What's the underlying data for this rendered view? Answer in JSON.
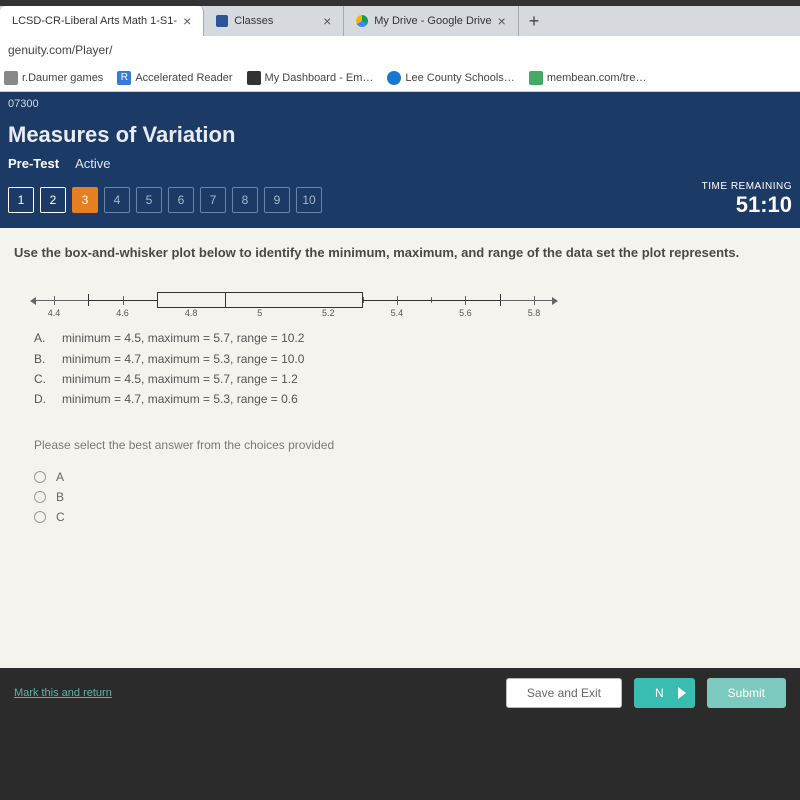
{
  "tabs": [
    {
      "title": "LCSD-CR-Liberal Arts Math 1-S1-",
      "active": true
    },
    {
      "title": "Classes"
    },
    {
      "title": "My Drive - Google Drive"
    }
  ],
  "url": "genuity.com/Player/",
  "bookmarks": [
    {
      "label": "r.Daumer games"
    },
    {
      "label": "Accelerated Reader"
    },
    {
      "label": "My Dashboard - Em…"
    },
    {
      "label": "Lee County Schools…"
    },
    {
      "label": "membean.com/tre…"
    }
  ],
  "course_code": "07300",
  "title": "Measures of Variation",
  "subnav": {
    "pretest": "Pre-Test",
    "active": "Active"
  },
  "questions": [
    "1",
    "2",
    "3",
    "4",
    "5",
    "6",
    "7",
    "8",
    "9",
    "10"
  ],
  "current_q": 3,
  "timer": {
    "label": "TIME REMAINING",
    "value": "51:10"
  },
  "prompt": "Use the box-and-whisker plot below to identify the minimum, maximum, and range of the data set the plot represents.",
  "chart_data": {
    "type": "boxplot",
    "axis_min": 4.4,
    "axis_max": 5.8,
    "ticks": [
      4.4,
      4.6,
      4.8,
      5.0,
      5.2,
      5.4,
      5.6,
      5.8
    ],
    "tick_labels": [
      "4.4",
      "4.6",
      "4.8",
      "5",
      "5.2",
      "5.4",
      "5.6",
      "5.8"
    ],
    "min": 4.5,
    "q1": 4.7,
    "median": 4.9,
    "q3": 5.3,
    "max": 5.7
  },
  "answers": [
    {
      "letter": "A.",
      "text": "minimum = 4.5, maximum = 5.7, range = 10.2"
    },
    {
      "letter": "B.",
      "text": "minimum = 4.7, maximum = 5.3, range = 10.0"
    },
    {
      "letter": "C.",
      "text": "minimum = 4.5, maximum = 5.7, range = 1.2"
    },
    {
      "letter": "D.",
      "text": "minimum = 4.7, maximum = 5.3, range = 0.6"
    }
  ],
  "instruction": "Please select the best answer from the choices provided",
  "choices": [
    "A",
    "B",
    "C"
  ],
  "footer": {
    "mark": "Mark this and return",
    "save": "Save and Exit",
    "next": "N",
    "submit": "Submit"
  }
}
